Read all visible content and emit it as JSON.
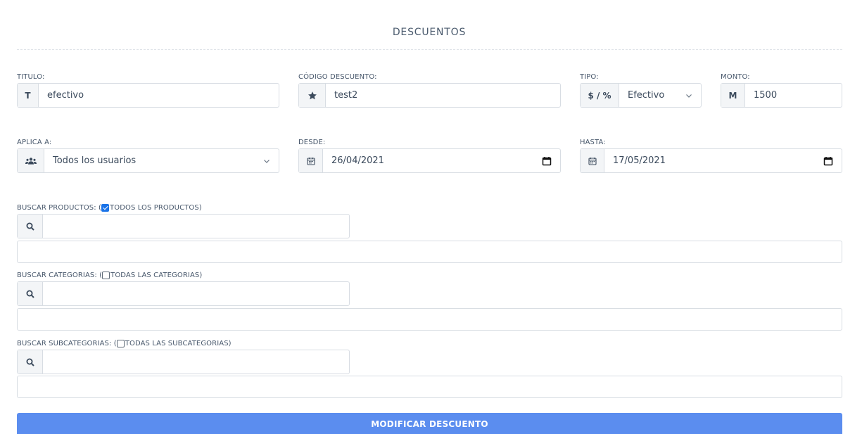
{
  "header": {
    "title": "DESCUENTOS"
  },
  "fields": {
    "titulo": {
      "label": "TITULO:",
      "addon": "T",
      "value": "efectivo"
    },
    "codigo": {
      "label": "CÓDIGO DESCUENTO:",
      "icon": "star-icon",
      "value": "test2"
    },
    "tipo": {
      "label": "TIPO:",
      "addon": "$ / %",
      "value": "Efectivo"
    },
    "monto": {
      "label": "MONTO:",
      "addon": "M",
      "value": "1500"
    },
    "aplica": {
      "label": "APLICA A:",
      "icon": "users-icon",
      "value": "Todos los usuarios"
    },
    "desde": {
      "label": "DESDE:",
      "icon": "calendar-icon",
      "value": "26/04/2021"
    },
    "hasta": {
      "label": "HASTA:",
      "icon": "calendar-icon",
      "value": "17/05/2021"
    }
  },
  "searches": {
    "productos": {
      "label_prefix": "BUSCAR PRODUCTOS: (",
      "checkbox_label": "TODOS LOS PRODUCTOS)",
      "checked": true,
      "value": ""
    },
    "categorias": {
      "label_prefix": "BUSCAR CATEGORIAS: (",
      "checkbox_label": "TODAS LAS CATEGORIAS)",
      "checked": false,
      "value": ""
    },
    "subcategorias": {
      "label_prefix": "BUSCAR SUBCATEGORIAS: (",
      "checkbox_label": "TODAS LAS SUBCATEGORIAS)",
      "checked": false,
      "value": ""
    }
  },
  "actions": {
    "submit_label": "MODIFICAR DESCUENTO"
  },
  "colors": {
    "accent": "#5b8def",
    "checkbox": "#1a73e8",
    "text": "#3b4a5c",
    "border": "#d8dde3",
    "addon_bg": "#f3f5f7"
  }
}
